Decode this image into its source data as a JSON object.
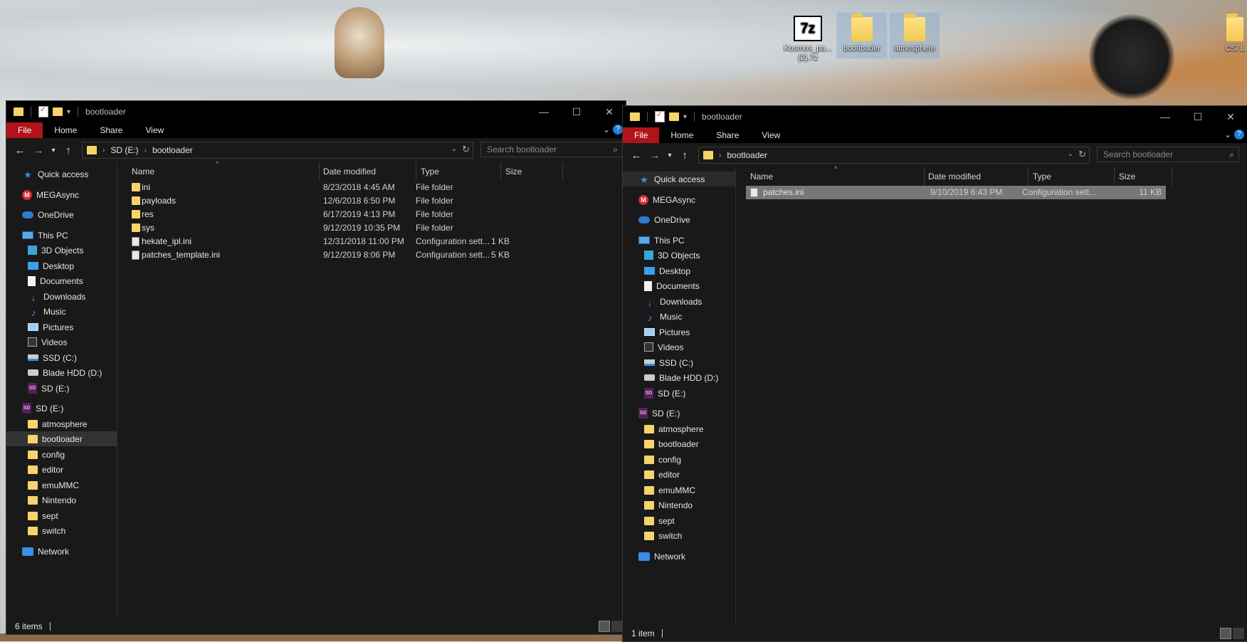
{
  "desktop": {
    "icons": [
      {
        "label": "Kosmos_pa...",
        "label2": "(2).7z",
        "glyph": "7z"
      },
      {
        "label": "bootloader"
      },
      {
        "label": "atmosphere"
      },
      {
        "label": "CSI L"
      }
    ]
  },
  "left": {
    "title": "bootloader",
    "ribbon": [
      "File",
      "Home",
      "Share",
      "View"
    ],
    "address": {
      "drive": "SD (E:)",
      "folder": "bootloader"
    },
    "search_placeholder": "Search bootloader",
    "columns": [
      "Name",
      "Date modified",
      "Type",
      "Size"
    ],
    "files": [
      {
        "name": "ini",
        "date": "8/23/2018 4:45 AM",
        "type": "File folder",
        "size": "",
        "kind": "folder"
      },
      {
        "name": "payloads",
        "date": "12/6/2018 6:50 PM",
        "type": "File folder",
        "size": "",
        "kind": "folder"
      },
      {
        "name": "res",
        "date": "6/17/2019 4:13 PM",
        "type": "File folder",
        "size": "",
        "kind": "folder"
      },
      {
        "name": "sys",
        "date": "9/12/2019 10:35 PM",
        "type": "File folder",
        "size": "",
        "kind": "folder"
      },
      {
        "name": "hekate_ipl.ini",
        "date": "12/31/2018 11:00 PM",
        "type": "Configuration sett...",
        "size": "1 KB",
        "kind": "config"
      },
      {
        "name": "patches_template.ini",
        "date": "9/12/2019 8:06 PM",
        "type": "Configuration sett...",
        "size": "5 KB",
        "kind": "config"
      }
    ],
    "status": "6 items"
  },
  "right": {
    "title": "bootloader",
    "ribbon": [
      "File",
      "Home",
      "Share",
      "View"
    ],
    "address": {
      "folder": "bootloader"
    },
    "search_placeholder": "Search bootloader",
    "columns": [
      "Name",
      "Date modified",
      "Type",
      "Size"
    ],
    "files": [
      {
        "name": "patches.ini",
        "date": "9/10/2019 6:43 PM",
        "type": "Configuration sett...",
        "size": "11 KB",
        "kind": "config"
      }
    ],
    "status": "1 item"
  },
  "nav": [
    {
      "label": "Quick access",
      "icon": "star-icon",
      "level": 0
    },
    {
      "label": "MEGAsync",
      "icon": "mega-icon",
      "level": 0
    },
    {
      "label": "OneDrive",
      "icon": "cloud-icon",
      "level": 0
    },
    {
      "label": "This PC",
      "icon": "pc-icon",
      "level": 0
    },
    {
      "label": "3D Objects",
      "icon": "cube-icon",
      "level": 1
    },
    {
      "label": "Desktop",
      "icon": "desktop-icon",
      "level": 1
    },
    {
      "label": "Documents",
      "icon": "document-icon",
      "level": 1
    },
    {
      "label": "Downloads",
      "icon": "download-icon",
      "level": 1
    },
    {
      "label": "Music",
      "icon": "music-icon",
      "level": 1
    },
    {
      "label": "Pictures",
      "icon": "pictures-icon",
      "level": 1
    },
    {
      "label": "Videos",
      "icon": "videos-icon",
      "level": 1
    },
    {
      "label": "SSD (C:)",
      "icon": "ssd-icon",
      "level": 1
    },
    {
      "label": "Blade HDD (D:)",
      "icon": "hdd-icon",
      "level": 1
    },
    {
      "label": "SD (E:)",
      "icon": "sd-icon",
      "level": 1
    },
    {
      "label": "SD (E:)",
      "icon": "sd-icon",
      "level": 0
    },
    {
      "label": "atmosphere",
      "icon": "folder-icon",
      "level": 1
    },
    {
      "label": "bootloader",
      "icon": "folder-icon",
      "level": 1
    },
    {
      "label": "config",
      "icon": "folder-icon",
      "level": 1
    },
    {
      "label": "editor",
      "icon": "folder-icon",
      "level": 1
    },
    {
      "label": "emuMMC",
      "icon": "folder-icon",
      "level": 1
    },
    {
      "label": "Nintendo",
      "icon": "folder-icon",
      "level": 1
    },
    {
      "label": "sept",
      "icon": "folder-icon",
      "level": 1
    },
    {
      "label": "switch",
      "icon": "folder-icon",
      "level": 1
    },
    {
      "label": "Network",
      "icon": "network-icon",
      "level": 0
    }
  ]
}
